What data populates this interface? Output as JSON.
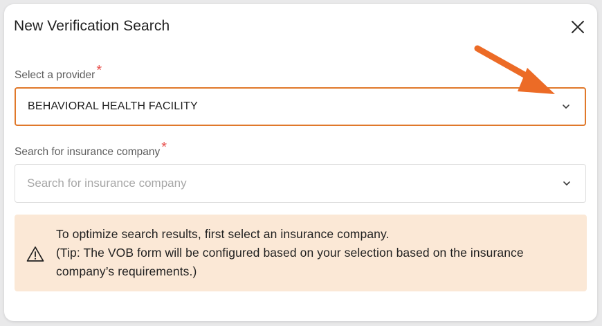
{
  "modal": {
    "title": "New Verification Search",
    "close_icon": "close-icon"
  },
  "provider": {
    "label": "Select a provider",
    "required_mark": "*",
    "value": "BEHAVIORAL HEALTH FACILITY",
    "dropdown_icon": "chevron-down-icon"
  },
  "insurance": {
    "label": "Search for insurance company",
    "required_mark": "*",
    "placeholder": "Search for insurance company",
    "dropdown_icon": "chevron-down-icon"
  },
  "notice": {
    "icon": "warning-icon",
    "line1": "To optimize search results, first select an insurance company.",
    "line2": "(Tip: The VOB form will be configured based on your selection based on the insurance",
    "line3": "company’s requirements.)"
  },
  "annotation": {
    "icon": "annotation-arrow-icon",
    "color": "#ec6b26"
  },
  "colors": {
    "accent": "#e0782a",
    "required": "#e8524f",
    "notice_bg": "#fbe8d6"
  }
}
